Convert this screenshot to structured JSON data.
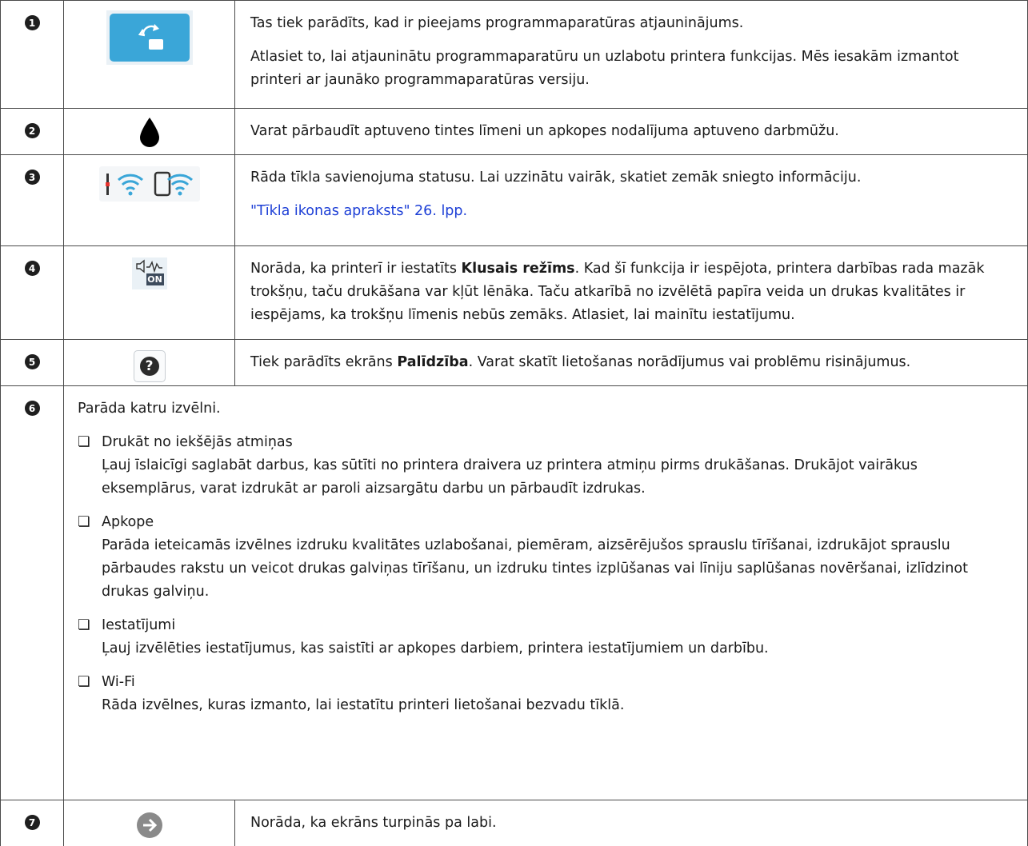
{
  "rows": [
    {
      "num": "1",
      "icon": "firmware-update-icon",
      "lines": [
        "Tas tiek parādīts, kad ir pieejams programmaparatūras atjauninājums.",
        "Atlasiet to, lai atjauninātu programmaparatūru un uzlabotu printera funkcijas. Mēs iesakām izmantot printeri ar jaunāko programmaparatūras versiju."
      ]
    },
    {
      "num": "2",
      "icon": "ink-drop-icon",
      "lines": [
        "Varat pārbaudīt aptuveno tintes līmeni un apkopes nodalījuma aptuveno darbmūžu."
      ]
    },
    {
      "num": "3",
      "icon": "network-status-icon",
      "lines": [
        "Rāda tīkla savienojuma statusu. Lai uzzinātu vairāk, skatiet zemāk sniegto informāciju."
      ],
      "link": "\"Tīkla ikonas apraksts\" 26. lpp."
    },
    {
      "num": "4",
      "icon": "quiet-mode-on-icon",
      "icon_text": "ON",
      "pre": "Norāda, ka printerī ir iestatīts ",
      "bold": "Klusais režīms",
      "post": ". Kad šī funkcija ir iespējota, printera darbības rada mazāk trokšņu, taču drukāšana var kļūt lēnāka. Taču atkarībā no izvēlētā papīra veida un drukas kvalitātes ir iespējams, ka trokšņu līmenis nebūs zemāks. Atlasiet, lai mainītu iestatījumu."
    },
    {
      "num": "5",
      "icon": "help-icon",
      "icon_text": "?",
      "pre": "Tiek parādīts ekrāns ",
      "bold": "Palīdzība",
      "post": ". Varat skatīt lietošanas norādījumus vai problēmu risinājumus."
    },
    {
      "num": "6",
      "intro": "Parāda katru izvēlni.",
      "checkbox": "❏",
      "items": [
        {
          "title": "Drukāt no iekšējās atmiņas",
          "desc": "Ļauj īslaicīgi saglabāt darbus, kas sūtīti no printera draivera uz printera atmiņu pirms drukāšanas. Drukājot vairākus eksemplārus, varat izdrukāt ar paroli aizsargātu darbu un pārbaudīt izdrukas."
        },
        {
          "title": "Apkope",
          "desc": "Parāda ieteicamās izvēlnes izdruku kvalitātes uzlabošanai, piemēram, aizsērējušos sprauslu tīrīšanai, izdrukājot sprauslu pārbaudes rakstu un veicot drukas galviņas tīrīšanu, un izdruku tintes izplūšanas vai līniju saplūšanas novēršanai, izlīdzinot drukas galviņu."
        },
        {
          "title": "Iestatījumi",
          "desc": "Ļauj izvēlēties iestatījumus, kas saistīti ar apkopes darbiem, printera iestatījumiem un darbību."
        },
        {
          "title": "Wi-Fi",
          "desc": "Rāda izvēlnes, kuras izmanto, lai iestatītu printeri lietošanai bezvadu tīklā."
        }
      ]
    },
    {
      "num": "7",
      "icon": "arrow-right-icon",
      "lines": [
        "Norāda, ka ekrāns turpinās pa labi."
      ]
    }
  ],
  "colors": {
    "icon_blue": "#3aa6d8",
    "border": "#4a4a4a",
    "link": "#1d3fd6"
  }
}
